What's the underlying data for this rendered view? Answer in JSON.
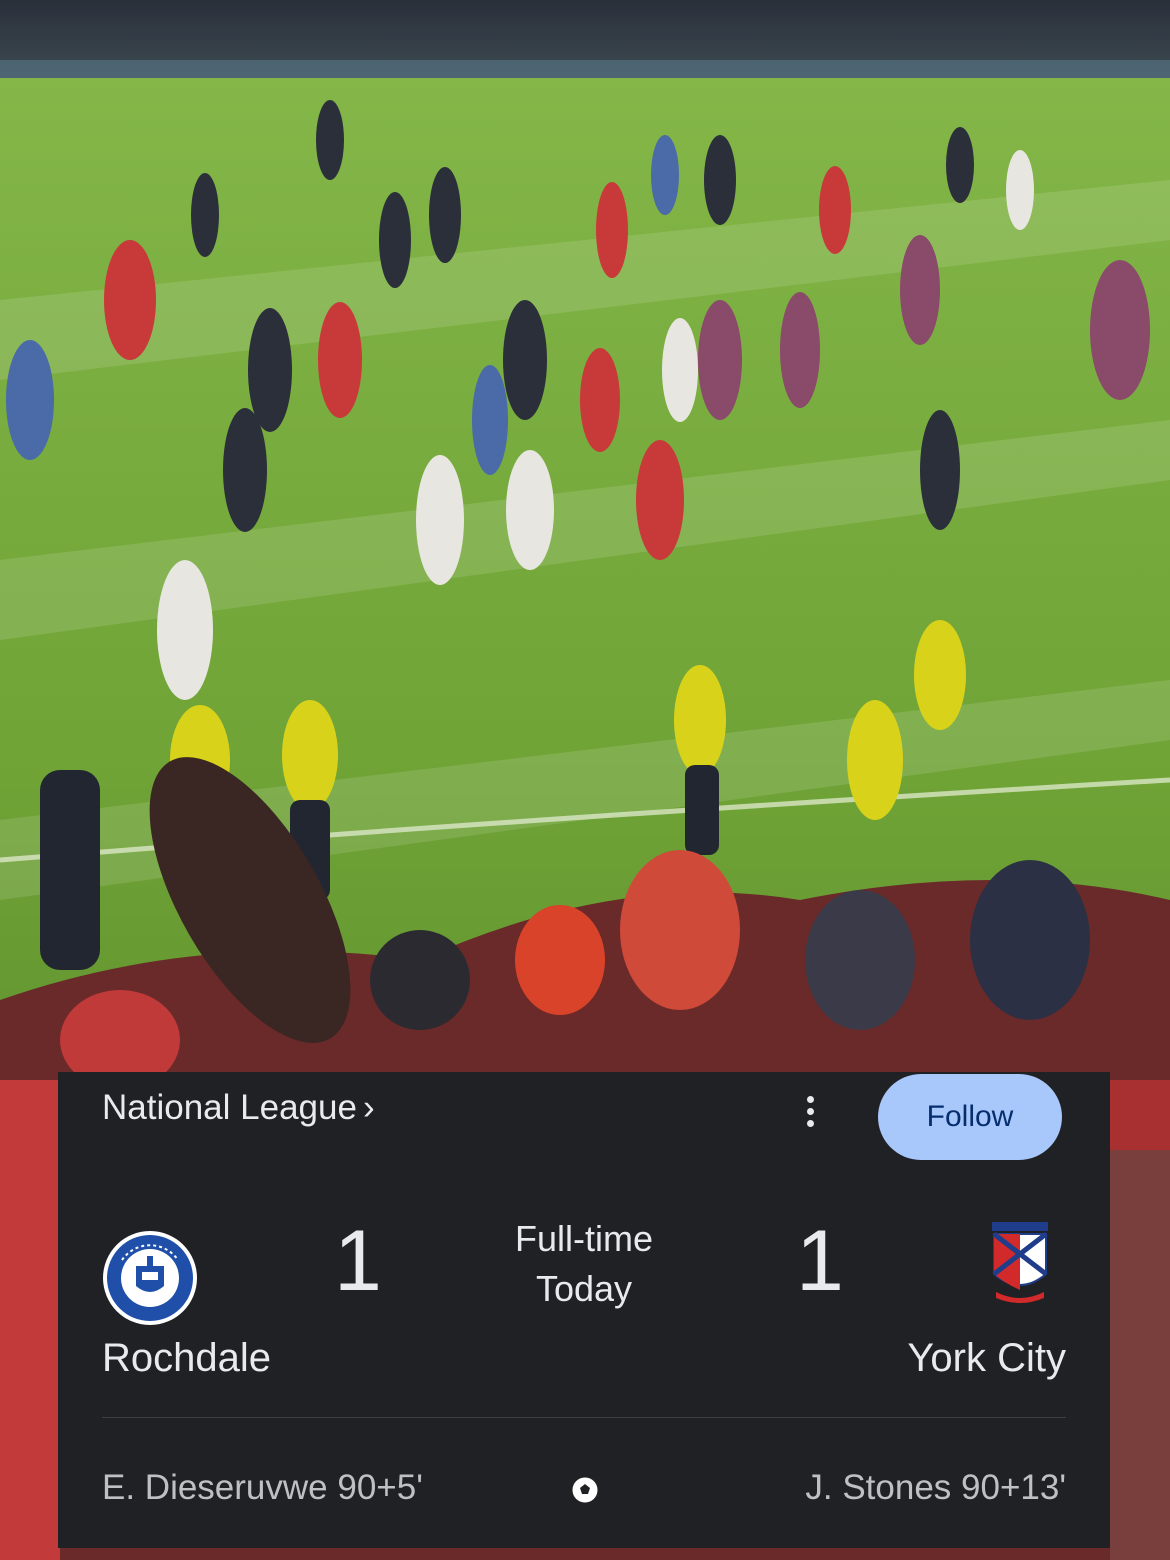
{
  "card": {
    "league": "National League",
    "league_chevron": "›",
    "more_icon": "more-vertical-icon",
    "follow_label": "Follow",
    "status": {
      "line1": "Full-time",
      "line2": "Today"
    },
    "home": {
      "name": "Rochdale",
      "score": "1",
      "crest_icon": "rochdale-crest-icon",
      "scorer": "E. Dieseruvwe 90+5'"
    },
    "away": {
      "name": "York City",
      "score": "1",
      "crest_icon": "york-city-crest-icon",
      "scorer": "J. Stones 90+13'"
    },
    "goal_icon": "soccer-ball-icon"
  },
  "colors": {
    "card_bg": "#202124",
    "text": "#e8eaed",
    "muted_text": "#bdc1c6",
    "follow_bg": "#a8c7fa",
    "follow_text": "#062e6f",
    "pitch": "#6a9a32"
  }
}
